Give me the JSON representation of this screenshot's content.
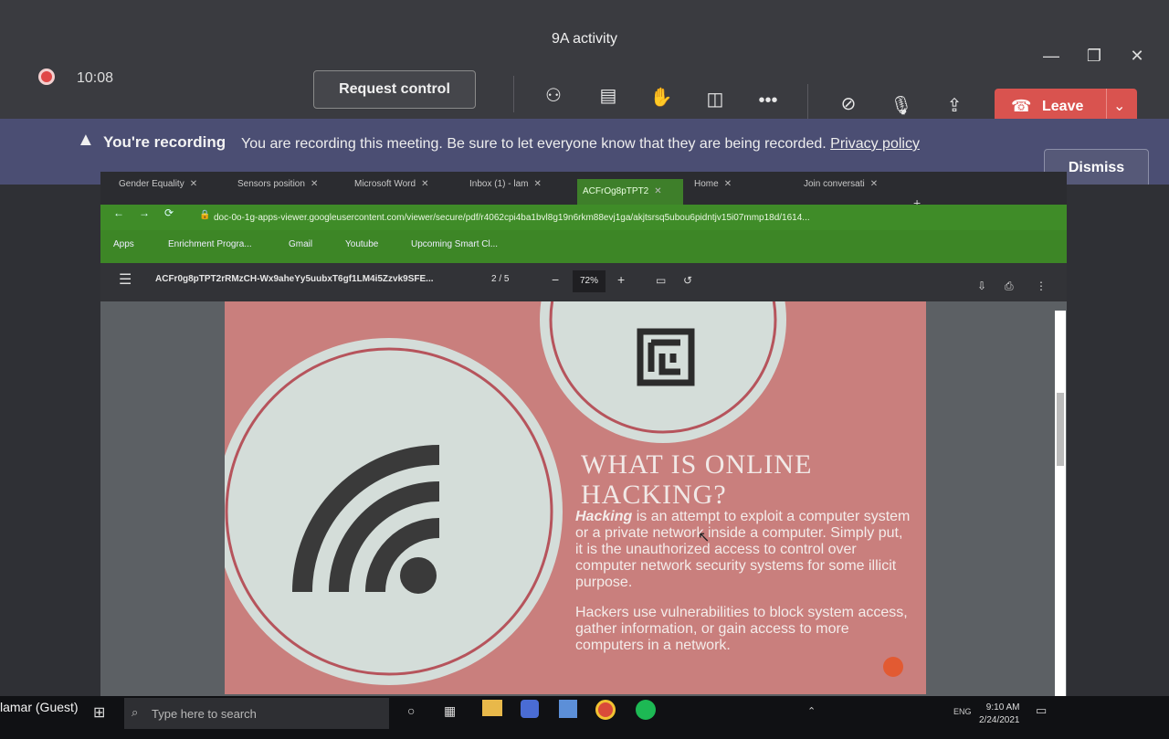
{
  "window": {
    "title": "9A activity"
  },
  "toolbar": {
    "time": "10:08",
    "request_control_label": "Request control",
    "leave_label": "Leave",
    "icons": [
      "people-icon",
      "chat-icon",
      "react-icon",
      "rooms-icon",
      "more-icon",
      "camera-off-icon",
      "mic-icon",
      "share-icon"
    ]
  },
  "banner": {
    "title": "You're recording",
    "message": "You are recording this meeting. Be sure to let everyone know that they are being recorded.",
    "link": "Privacy policy",
    "dismiss_label": "Dismiss"
  },
  "browser": {
    "tabs": [
      {
        "label": "Gender Equality"
      },
      {
        "label": "Sensors position"
      },
      {
        "label": "Microsoft Word"
      },
      {
        "label": "Inbox (1) - lam"
      },
      {
        "label": "ACFrOg8pTPT2"
      },
      {
        "label": "Home"
      },
      {
        "label": "Join conversati"
      }
    ],
    "url": "doc-0o-1g-apps-viewer.googleusercontent.com/viewer/secure/pdf/r4062cpi4ba1bvl8g19n6rkm88evj1ga/akjtsrsq5ubou6pidntjv15i07mmp18d/1614...",
    "bookmarks": [
      "Apps",
      "Enrichment Progra...",
      "Gmail",
      "Youtube",
      "Upcoming Smart Cl..."
    ]
  },
  "pdf": {
    "filename": "ACFr0g8pTPT2rRMzCH-Wx9aheYy5uubxT6gf1LM4i5Zzvk9SFE...",
    "page": "2 / 5",
    "zoom": "72%"
  },
  "slide": {
    "title_line1": "WHAT IS ONLINE",
    "title_line2": "HACKING?",
    "bullet1_keyword": "Hacking",
    "bullet1_rest": " is an attempt to exploit a computer system or a private network inside a computer. Simply put, it is the unauthorized access to control over computer network security systems for some illicit purpose.",
    "bullet2": "Hackers use vulnerabilities to block system access, gather information, or gain access to more computers in a network."
  },
  "taskbar": {
    "guest": "lamar (Guest)",
    "search_placeholder": "Type here to search",
    "lang": "ENG",
    "time": "9:10 AM",
    "date": "2/24/2021"
  },
  "colors": {
    "leave": "#d9534f",
    "banner": "#4b4e73",
    "slide_bg": "#c97f7d",
    "chrome_green": "#3f8c28"
  }
}
